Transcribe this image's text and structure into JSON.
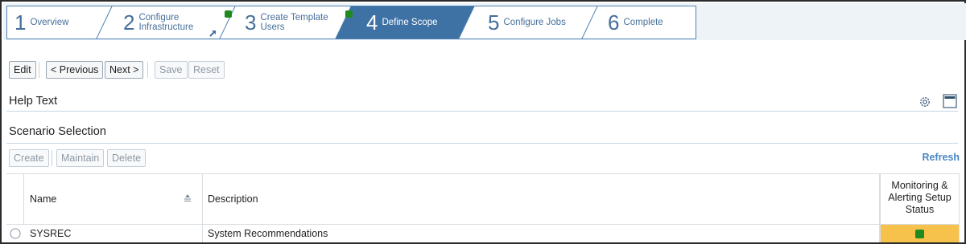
{
  "roadmap": {
    "steps": [
      {
        "num": "1",
        "label": "Overview"
      },
      {
        "num": "2",
        "label_line1": "Configure",
        "label_line2": "Infrastructure"
      },
      {
        "num": "3",
        "label_line1": "Create Template",
        "label_line2": "Users"
      },
      {
        "num": "4",
        "label": "Define Scope"
      },
      {
        "num": "5",
        "label": "Configure Jobs"
      },
      {
        "num": "6",
        "label": "Complete"
      }
    ],
    "active_step": "4",
    "completed_steps": [
      "2",
      "3"
    ],
    "colors": {
      "border": "#4f83b4",
      "active": "#3e72a5",
      "text": "#466f9a",
      "done": "#1f8a1f"
    }
  },
  "toolbar": {
    "edit": "Edit",
    "previous": "< Previous",
    "next": "Next >",
    "save": "Save",
    "reset": "Reset"
  },
  "help_text": {
    "title": "Help Text",
    "settings_icon": "gear-icon",
    "panel_icon": "window-icon"
  },
  "scenario": {
    "title": "Scenario Selection",
    "actions": {
      "create": "Create",
      "maintain": "Maintain",
      "delete": "Delete",
      "refresh": "Refresh"
    },
    "columns": {
      "name": "Name",
      "description": "Description",
      "status_line1": "Monitoring &",
      "status_line2": "Alerting Setup",
      "status_line3": "Status"
    },
    "rows": [
      {
        "name": "SYSREC",
        "description": "System Recommendations",
        "status_color": "#f7c24b",
        "status_indicator": "#1f8a1f"
      }
    ]
  }
}
